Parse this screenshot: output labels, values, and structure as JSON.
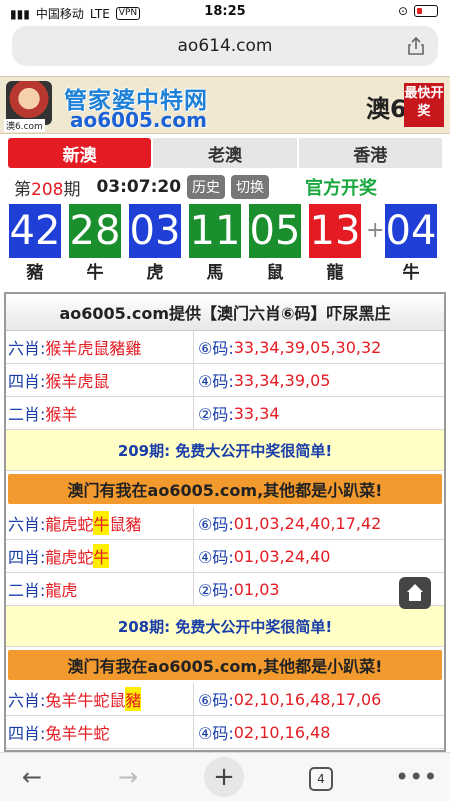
{
  "statusbar": {
    "carrier": "中国移动",
    "network": "LTE",
    "vpn": "VPN",
    "time": "18:25"
  },
  "browser": {
    "url": "ao614.com",
    "tab_count": "4"
  },
  "banner": {
    "site_name": "管家婆中特网",
    "site_domain": "ao6005.com",
    "avatar_label": "澳6.com",
    "right_text": "澳6",
    "badge_text": "最快开奖"
  },
  "tabs": [
    {
      "label": "新澳"
    },
    {
      "label": "老澳"
    },
    {
      "label": "香港"
    }
  ],
  "draw": {
    "prefix": "第",
    "number": "208",
    "suffix": "期",
    "clock": "03:07:20",
    "history": "历史",
    "switch": "切换",
    "official": "官方开奖"
  },
  "balls": [
    {
      "num": "42",
      "zodiac": "豬",
      "color": "#1f3fd6"
    },
    {
      "num": "28",
      "zodiac": "牛",
      "color": "#1b8f2e"
    },
    {
      "num": "03",
      "zodiac": "虎",
      "color": "#1f3fd6"
    },
    {
      "num": "11",
      "zodiac": "馬",
      "color": "#1b8f2e"
    },
    {
      "num": "05",
      "zodiac": "鼠",
      "color": "#1b8f2e"
    },
    {
      "num": "13",
      "zodiac": "龍",
      "color": "#e51b23"
    }
  ],
  "special_ball": {
    "num": "04",
    "zodiac": "牛",
    "color": "#1f3fd6"
  },
  "plus": "+",
  "content": {
    "header": "ao6005.com提供【澳门六肖⑥码】吓尿黑庄",
    "block1": [
      {
        "label": "六肖:",
        "zodiacs": "猴羊虎鼠豬雞",
        "codes_label": "⑥码:",
        "codes": "33,34,39,05,30,32"
      },
      {
        "label": "四肖:",
        "zodiacs": "猴羊虎鼠",
        "codes_label": "④码:",
        "codes": "33,34,39,05"
      },
      {
        "label": "二肖:",
        "zodiacs": "猴羊",
        "codes_label": "②码:",
        "codes": "33,34"
      }
    ],
    "promo1": "209期: 免费大公开中奖很简单!",
    "orange1": "澳门有我在ao6005.com,其他都是小趴菜!",
    "block2": [
      {
        "label": "六肖:",
        "pre": "龍虎蛇",
        "hl": "牛",
        "post": "鼠豬",
        "codes_label": "⑥码:",
        "codes": "01,03,24,40,17,42"
      },
      {
        "label": "四肖:",
        "pre": "龍虎蛇",
        "hl": "牛",
        "post": "",
        "codes_label": "④码:",
        "codes": "01,03,24,40"
      },
      {
        "label": "二肖:",
        "pre": "龍虎",
        "hl": "",
        "post": "",
        "codes_label": "②码:",
        "codes": "01,03"
      }
    ],
    "promo2": "208期: 免费大公开中奖很简单!",
    "orange2": "澳门有我在ao6005.com,其他都是小趴菜!",
    "block3": [
      {
        "label": "六肖:",
        "pre": "兔羊牛蛇鼠",
        "hl": "豬",
        "post": "",
        "codes_label": "⑥码:",
        "codes": "02,10,16,48,17,06"
      },
      {
        "label": "四肖:",
        "pre": "兔羊牛蛇",
        "hl": "",
        "post": "",
        "codes_label": "④码:",
        "codes": "02,10,16,48"
      }
    ]
  }
}
